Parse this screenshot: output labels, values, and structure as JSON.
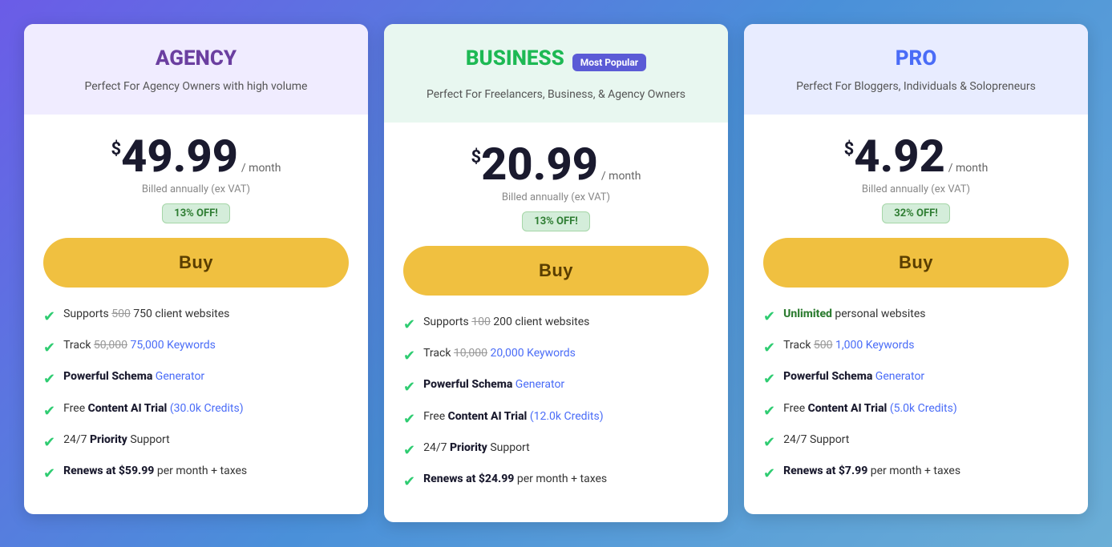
{
  "plans": [
    {
      "id": "agency",
      "name": "AGENCY",
      "header_class": "agency-header",
      "description": "Perfect For Agency Owners with high volume",
      "most_popular": false,
      "price_currency": "$",
      "price_amount": "49.99",
      "price_period": "/ month",
      "billed_text": "Billed annually (ex VAT)",
      "discount": "13% OFF!",
      "buy_label": "Buy",
      "features": [
        {
          "text_parts": [
            {
              "type": "normal",
              "text": "Supports "
            },
            {
              "type": "strikethrough",
              "text": "500"
            },
            {
              "type": "normal",
              "text": " 750 client websites"
            }
          ]
        },
        {
          "text_parts": [
            {
              "type": "normal",
              "text": "Track "
            },
            {
              "type": "strikethrough",
              "text": "50,000"
            },
            {
              "type": "normal",
              "text": " "
            },
            {
              "type": "link",
              "text": "75,000 Keywords"
            }
          ]
        },
        {
          "text_parts": [
            {
              "type": "bold",
              "text": "Powerful Schema"
            },
            {
              "type": "normal",
              "text": " "
            },
            {
              "type": "link",
              "text": "Generator"
            }
          ]
        },
        {
          "text_parts": [
            {
              "type": "normal",
              "text": "Free "
            },
            {
              "type": "bold",
              "text": "Content AI Trial"
            },
            {
              "type": "normal",
              "text": " "
            },
            {
              "type": "link",
              "text": "(30.0k Credits)"
            }
          ]
        },
        {
          "text_parts": [
            {
              "type": "normal",
              "text": "24/7 "
            },
            {
              "type": "bold",
              "text": "Priority"
            },
            {
              "type": "normal",
              "text": " Support"
            }
          ]
        },
        {
          "text_parts": [
            {
              "type": "bold",
              "text": "Renews at $59.99"
            },
            {
              "type": "normal",
              "text": " per month + taxes"
            }
          ]
        }
      ]
    },
    {
      "id": "business",
      "name": "BUSINESS",
      "header_class": "business-header",
      "description": "Perfect For Freelancers, Business, & Agency Owners",
      "most_popular": true,
      "most_popular_label": "Most Popular",
      "price_currency": "$",
      "price_amount": "20.99",
      "price_period": "/ month",
      "billed_text": "Billed annually (ex VAT)",
      "discount": "13% OFF!",
      "buy_label": "Buy",
      "features": [
        {
          "text_parts": [
            {
              "type": "normal",
              "text": "Supports "
            },
            {
              "type": "strikethrough",
              "text": "100"
            },
            {
              "type": "normal",
              "text": " 200 client websites"
            }
          ]
        },
        {
          "text_parts": [
            {
              "type": "normal",
              "text": "Track "
            },
            {
              "type": "strikethrough",
              "text": "10,000"
            },
            {
              "type": "normal",
              "text": " "
            },
            {
              "type": "link",
              "text": "20,000 Keywords"
            }
          ]
        },
        {
          "text_parts": [
            {
              "type": "bold",
              "text": "Powerful Schema"
            },
            {
              "type": "normal",
              "text": " "
            },
            {
              "type": "link",
              "text": "Generator"
            }
          ]
        },
        {
          "text_parts": [
            {
              "type": "normal",
              "text": "Free "
            },
            {
              "type": "bold",
              "text": "Content AI Trial"
            },
            {
              "type": "normal",
              "text": " "
            },
            {
              "type": "link",
              "text": "(12.0k Credits)"
            }
          ]
        },
        {
          "text_parts": [
            {
              "type": "normal",
              "text": "24/7 "
            },
            {
              "type": "bold",
              "text": "Priority"
            },
            {
              "type": "normal",
              "text": " Support"
            }
          ]
        },
        {
          "text_parts": [
            {
              "type": "bold",
              "text": "Renews at $24.99"
            },
            {
              "type": "normal",
              "text": " per month + taxes"
            }
          ]
        }
      ]
    },
    {
      "id": "pro",
      "name": "PRO",
      "header_class": "pro-header",
      "description": "Perfect For Bloggers, Individuals & Solopreneurs",
      "most_popular": false,
      "price_currency": "$",
      "price_amount": "4.92",
      "price_period": "/ month",
      "billed_text": "Billed annually (ex VAT)",
      "discount": "32% OFF!",
      "buy_label": "Buy",
      "features": [
        {
          "text_parts": [
            {
              "type": "highlight",
              "text": "Unlimited"
            },
            {
              "type": "normal",
              "text": " personal websites"
            }
          ]
        },
        {
          "text_parts": [
            {
              "type": "normal",
              "text": "Track "
            },
            {
              "type": "strikethrough",
              "text": "500"
            },
            {
              "type": "normal",
              "text": " "
            },
            {
              "type": "link",
              "text": "1,000 Keywords"
            }
          ]
        },
        {
          "text_parts": [
            {
              "type": "bold",
              "text": "Powerful Schema"
            },
            {
              "type": "normal",
              "text": " "
            },
            {
              "type": "link",
              "text": "Generator"
            }
          ]
        },
        {
          "text_parts": [
            {
              "type": "normal",
              "text": "Free "
            },
            {
              "type": "bold",
              "text": "Content AI Trial"
            },
            {
              "type": "normal",
              "text": " "
            },
            {
              "type": "link",
              "text": "(5.0k Credits)"
            }
          ]
        },
        {
          "text_parts": [
            {
              "type": "normal",
              "text": "24/7 Support"
            }
          ]
        },
        {
          "text_parts": [
            {
              "type": "bold",
              "text": "Renews at $7.99"
            },
            {
              "type": "normal",
              "text": " per month + taxes"
            }
          ]
        }
      ]
    }
  ]
}
